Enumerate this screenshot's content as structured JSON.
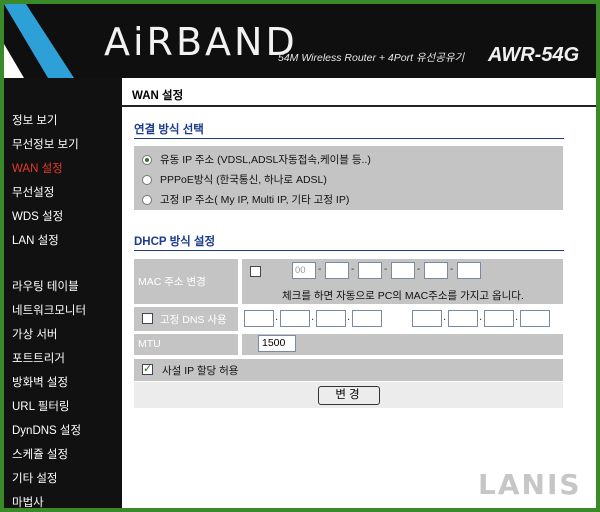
{
  "header": {
    "brand": "AiRBAND",
    "subtitle": "54M Wireless Router + 4Port 유선공유기",
    "model": "AWR-54G",
    "accent_color": "#2ea0d8"
  },
  "sidebar": {
    "items": [
      {
        "label": "정보 보기"
      },
      {
        "label": "무선정보 보기"
      },
      {
        "label": "WAN 설정",
        "active": true
      },
      {
        "label": "무선설정"
      },
      {
        "label": "WDS 설정"
      },
      {
        "label": "LAN 설정"
      },
      {
        "label": "라우팅 테이블"
      },
      {
        "label": "네트워크모니터"
      },
      {
        "label": "가상 서버"
      },
      {
        "label": "포트트리거"
      },
      {
        "label": "방화벽 설정"
      },
      {
        "label": "URL 필터링"
      },
      {
        "label": "DynDNS 설정"
      },
      {
        "label": "스케쥴 설정"
      },
      {
        "label": "기타 설정"
      },
      {
        "label": "마법사"
      }
    ]
  },
  "main": {
    "title": "WAN 설정",
    "connection": {
      "heading": "연결 방식 선택",
      "options": [
        {
          "label": "유동 IP 주소 (VDSL,ADSL자동접속,케이블 등..)",
          "selected": true
        },
        {
          "label": "PPPoE방식 (한국통신, 하나로 ADSL)",
          "selected": false
        },
        {
          "label": "고정 IP 주소( My IP, Multi IP, 기타 고정 IP)",
          "selected": false
        }
      ]
    },
    "dhcp": {
      "heading": "DHCP 방식 설정",
      "mac_label": "MAC 주소 변경",
      "mac_fields": [
        "00",
        "",
        "",
        "",
        "",
        ""
      ],
      "mac_note": "체크를 하면 자동으로 PC의 MAC주소를 가지고 옵니다.",
      "dns_label": "고정 DNS 사용",
      "mtu_label": "MTU",
      "mtu_value": "1500",
      "private_ip_label": "사설 IP 할당 허용",
      "private_ip_checked": true,
      "apply_label": "변경"
    }
  },
  "watermark": "LANIS"
}
